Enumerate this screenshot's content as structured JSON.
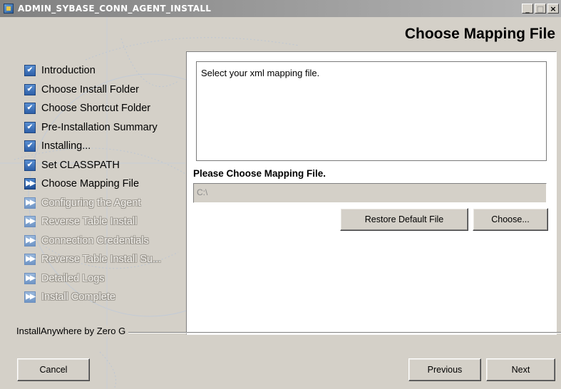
{
  "window": {
    "title": "ADMIN_SYBASE_CONN_AGENT_INSTALL",
    "minimize_glyph": "_",
    "maximize_glyph": "□",
    "close_glyph": "×"
  },
  "header": {
    "title": "Choose Mapping File"
  },
  "steps": [
    {
      "label": "Introduction",
      "state": "done"
    },
    {
      "label": "Choose Install Folder",
      "state": "done"
    },
    {
      "label": "Choose Shortcut Folder",
      "state": "done"
    },
    {
      "label": "Pre-Installation Summary",
      "state": "done"
    },
    {
      "label": "Installing...",
      "state": "done"
    },
    {
      "label": "Set CLASSPATH",
      "state": "done"
    },
    {
      "label": "Choose Mapping File",
      "state": "current"
    },
    {
      "label": "Configuring the Agent",
      "state": "pending"
    },
    {
      "label": "Reverse Table Install",
      "state": "pending"
    },
    {
      "label": "Connection Credentials",
      "state": "pending"
    },
    {
      "label": "Reverse Table Install Su...",
      "state": "pending"
    },
    {
      "label": "Detailed Logs",
      "state": "pending"
    },
    {
      "label": "Install Complete",
      "state": "pending"
    }
  ],
  "step_icons": {
    "done": "✔",
    "current": "▶▶",
    "pending": "▶▶"
  },
  "main": {
    "instruction": "Select your xml mapping file.",
    "field_label": "Please Choose Mapping File.",
    "path_value": "C:\\",
    "restore_label": "Restore Default File",
    "choose_label": "Choose..."
  },
  "footer": {
    "brand": "InstallAnywhere by Zero G",
    "cancel_label": "Cancel",
    "previous_label": "Previous",
    "next_label": "Next"
  },
  "colors": {
    "dialog_bg": "#d4d0c8",
    "titlebar_start": "#808080",
    "titlebar_end": "#b6b6b6",
    "check_blue": "#2d5fa8",
    "pending_text": "#f4f2ee"
  }
}
